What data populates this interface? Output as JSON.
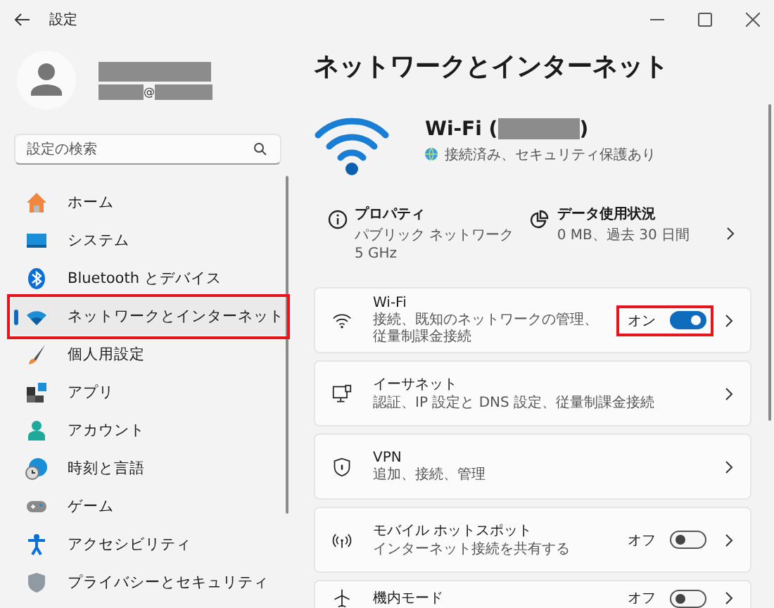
{
  "window": {
    "title": "設定"
  },
  "account": {
    "email_fragment": "@"
  },
  "search": {
    "placeholder": "設定の検索"
  },
  "nav": [
    {
      "label": "ホーム",
      "kind": "home",
      "selected": false,
      "highlighted": false
    },
    {
      "label": "システム",
      "kind": "system",
      "selected": false,
      "highlighted": false
    },
    {
      "label": "Bluetooth とデバイス",
      "kind": "bluetooth",
      "selected": false,
      "highlighted": false
    },
    {
      "label": "ネットワークとインターネット",
      "kind": "network",
      "selected": true,
      "highlighted": true
    },
    {
      "label": "個人用設定",
      "kind": "brush",
      "selected": false,
      "highlighted": false
    },
    {
      "label": "アプリ",
      "kind": "apps",
      "selected": false,
      "highlighted": false
    },
    {
      "label": "アカウント",
      "kind": "account",
      "selected": false,
      "highlighted": false
    },
    {
      "label": "時刻と言語",
      "kind": "time",
      "selected": false,
      "highlighted": false
    },
    {
      "label": "ゲーム",
      "kind": "game",
      "selected": false,
      "highlighted": false
    },
    {
      "label": "アクセシビリティ",
      "kind": "accessibility",
      "selected": false,
      "highlighted": false
    },
    {
      "label": "プライバシーとセキュリティ",
      "kind": "shield",
      "selected": false,
      "highlighted": false
    }
  ],
  "page": {
    "title": "ネットワークとインターネット"
  },
  "connection": {
    "name_open": "Wi-Fi (",
    "name_close": ")",
    "status": "接続済み、セキュリティ保護あり"
  },
  "properties": {
    "title": "プロパティ",
    "lines": [
      "パブリック ネットワーク",
      "5 GHz"
    ]
  },
  "data_usage": {
    "title": "データ使用状況",
    "detail": "0 MB、過去 30 日間"
  },
  "settings": [
    {
      "kind": "wifi",
      "title": "Wi-Fi",
      "subtitle": "接続、既知のネットワークの管理、従量制課金接続",
      "toggle": {
        "label": "オン",
        "on": true
      },
      "highlighted": true
    },
    {
      "kind": "ethernet",
      "title": "イーサネット",
      "subtitle": "認証、IP 設定と DNS 設定、従量制課金接続",
      "highlighted": false
    },
    {
      "kind": "vpn",
      "title": "VPN",
      "subtitle": "追加、接続、管理",
      "highlighted": false
    },
    {
      "kind": "hotspot",
      "title": "モバイル ホットスポット",
      "subtitle": "インターネット接続を共有する",
      "toggle": {
        "label": "オフ",
        "on": false
      },
      "highlighted": false
    },
    {
      "kind": "airplane",
      "title": "機内モード",
      "toggle": {
        "label": "オフ",
        "on": false
      },
      "highlighted": false
    }
  ]
}
